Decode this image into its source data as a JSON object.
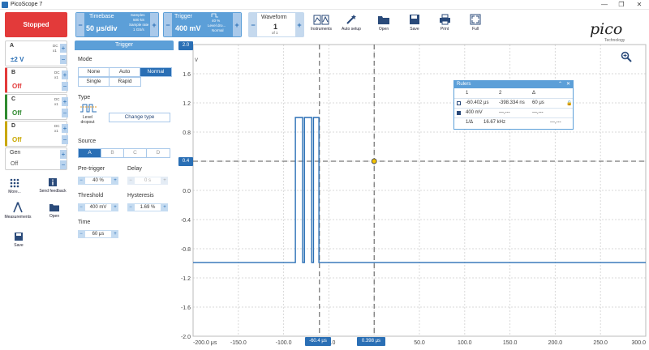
{
  "app": {
    "title": "PicoScope 7",
    "win_min": "—",
    "win_restore": "❐",
    "win_close": "✕"
  },
  "toolbar": {
    "run_button": "Stopped",
    "timebase": {
      "label": "Timebase",
      "value": "50 μs/div",
      "samples_label": "Samples",
      "samples_value": "500 kS",
      "rate_label": "Sample rate",
      "rate_value": "1 GS/s"
    },
    "trigger": {
      "label": "Trigger",
      "value": "400 mV",
      "pct": "40 %",
      "type": "Level dro...",
      "mode": "Normal"
    },
    "waveform": {
      "label": "Waveform",
      "value": "1",
      "of": "of 1"
    },
    "tools": [
      "Instruments",
      "Auto setup",
      "Open",
      "Save",
      "Print",
      "Full"
    ],
    "plus": "+",
    "minus": "−"
  },
  "logo": {
    "brand": "pico",
    "tag": "Technology"
  },
  "channels": [
    {
      "letter": "A",
      "range": "±2 V",
      "dc": "DC",
      "probe": "x1",
      "color": "#2a6fb5"
    },
    {
      "letter": "B",
      "range": "Off",
      "dc": "DC",
      "probe": "x1",
      "color": "#e33a3a"
    },
    {
      "letter": "C",
      "range": "Off",
      "dc": "DC",
      "probe": "x1",
      "color": "#2f8a2f"
    },
    {
      "letter": "D",
      "range": "Off",
      "dc": "DC",
      "probe": "x1",
      "color": "#c9a800"
    },
    {
      "letter": "Gen",
      "range": "Off",
      "dc": "",
      "probe": "",
      "color": "#555"
    }
  ],
  "left_tools": {
    "more": "More...",
    "feedback": "Send feedback",
    "measurements": "Measurements",
    "open": "Open",
    "save": "Save"
  },
  "trigger_panel": {
    "header": "Trigger",
    "mode_label": "Mode",
    "modes": [
      "None",
      "Auto",
      "Normal",
      "Single",
      "Rapid"
    ],
    "type_label": "Type",
    "type_caption": "Level dropout",
    "change_type": "Change type",
    "source_label": "Source",
    "sources": [
      "A",
      "B",
      "C",
      "D"
    ],
    "pretrigger_label": "Pre-trigger",
    "pretrigger_value": "40 %",
    "delay_label": "Delay",
    "delay_value": "0 s",
    "threshold_label": "Threshold",
    "threshold_value": "400 mV",
    "hysteresis_label": "Hysteresis",
    "hysteresis_value": "1.69 %",
    "time_label": "Time",
    "time_value": "60 μs"
  },
  "scope": {
    "y_unit": "V",
    "y_ticks": [
      "2.0",
      "1.6",
      "1.2",
      "0.8",
      "0.4",
      "0.0",
      "-0.4",
      "-0.8",
      "-1.2",
      "-1.6",
      "-2.0"
    ],
    "x_ticks": [
      "-200.0 μs",
      "-150.0",
      "-100.0",
      "-50.0",
      "0.0",
      "50.0",
      "100.0",
      "150.0",
      "200.0",
      "250.0",
      "300.0"
    ],
    "trigger_level_badge": "0.4",
    "top_badge": "2.0",
    "ruler1_badge": "-60.4 μs",
    "ruler2_badge": "0.398 μs",
    "trace_color": "#2a6fb5"
  },
  "rulers": {
    "title": "Rulers",
    "col1": "1",
    "col2": "2",
    "col3": "Δ",
    "t1": "-60.402 μs",
    "t2": "-398.334 ns",
    "dt": "60 μs",
    "v1": "400 mV",
    "v2": "---,---",
    "dv": "---,---",
    "inv_label": "1/Δ",
    "inv_value": "16.67 kHz",
    "inv_v": "---,---"
  }
}
